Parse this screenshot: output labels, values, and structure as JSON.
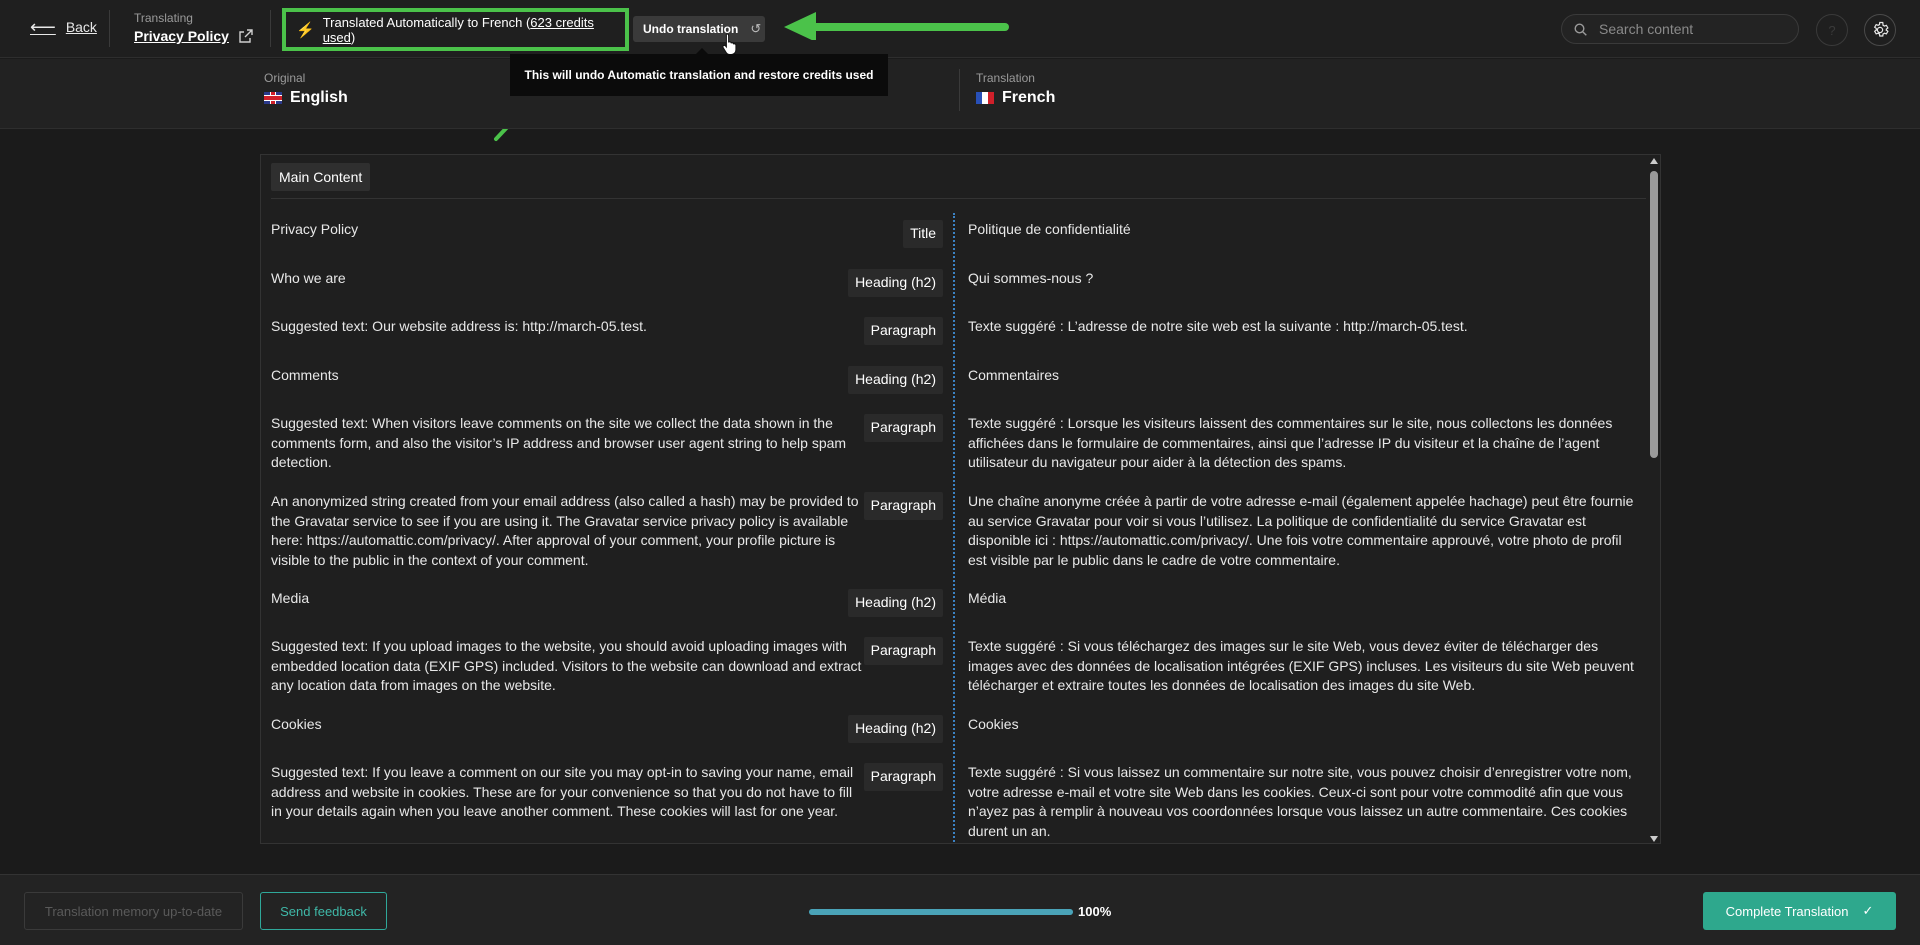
{
  "header": {
    "back_label": "Back",
    "translating_label": "Translating",
    "document_title": "Privacy Policy",
    "auto_status_prefix": "Translated Automatically to French (",
    "auto_status_credits": "623 credits used",
    "auto_status_suffix": ")",
    "undo_label": "Undo translation",
    "search_placeholder": "Search content",
    "help_icon": "help-icon",
    "settings_icon": "gear-icon"
  },
  "tooltip": {
    "text": "This will undo Automatic translation and restore credits used"
  },
  "languages": {
    "original_label": "Original",
    "original_name": "English",
    "translation_label": "Translation",
    "translation_name": "French"
  },
  "content": {
    "section": "Main Content",
    "rows": [
      {
        "original": "Privacy Policy",
        "type": "Title",
        "translation": "Politique de confidentialité"
      },
      {
        "original": "Who we are",
        "type": "Heading (h2)",
        "translation": "Qui sommes-nous ?"
      },
      {
        "original": "Suggested text: Our website address is: http://march-05.test.",
        "type": "Paragraph",
        "translation": "Texte suggéré : L’adresse de notre site web est la suivante : http://march-05.test."
      },
      {
        "original": "Comments",
        "type": "Heading (h2)",
        "translation": "Commentaires"
      },
      {
        "original": "Suggested text: When visitors leave comments on the site we collect the data shown in the comments form, and also the visitor’s IP address and browser user agent string to help spam detection.",
        "type": "Paragraph",
        "translation": "Texte suggéré : Lorsque les visiteurs laissent des commentaires sur le site, nous collectons les données affichées dans le formulaire de commentaires, ainsi que l’adresse IP du visiteur et la chaîne de l’agent utilisateur du navigateur pour aider à la détection des spams."
      },
      {
        "original": "An anonymized string created from your email address (also called a hash) may be provided to the Gravatar service to see if you are using it. The Gravatar service privacy policy is available here: https://automattic.com/privacy/. After approval of your comment, your profile picture is visible to the public in the context of your comment.",
        "type": "Paragraph",
        "translation": "Une chaîne anonyme créée à partir de votre adresse e-mail (également appelée hachage) peut être fournie au service Gravatar pour voir si vous l’utilisez. La politique de confidentialité du service Gravatar est disponible ici : https://automattic.com/privacy/. Une fois votre commentaire approuvé, votre photo de profil est visible par le public dans le cadre de votre commentaire."
      },
      {
        "original": "Media",
        "type": "Heading (h2)",
        "translation": "Média"
      },
      {
        "original": "Suggested text: If you upload images to the website, you should avoid uploading images with embedded location data (EXIF GPS) included. Visitors to the website can download and extract any location data from images on the website.",
        "type": "Paragraph",
        "translation": "Texte suggéré : Si vous téléchargez des images sur le site Web, vous devez éviter de télécharger des images avec des données de localisation intégrées (EXIF GPS) incluses. Les visiteurs du site Web peuvent télécharger et extraire toutes les données de localisation des images du site Web."
      },
      {
        "original": "Cookies",
        "type": "Heading (h2)",
        "translation": "Cookies"
      },
      {
        "original": "Suggested text: If you leave a comment on our site you may opt-in to saving your name, email address and website in cookies. These are for your convenience so that you do not have to fill in your details again when you leave another comment. These cookies will last for one year.",
        "type": "Paragraph",
        "translation": "Texte suggéré : Si vous laissez un commentaire sur notre site, vous pouvez choisir d’enregistrer votre nom, votre adresse e-mail et votre site Web dans les cookies. Ceux-ci sont pour votre commodité afin que vous n’ayez pas à remplir à nouveau vos coordonnées lorsque vous laissez un autre commentaire. Ces cookies durent un an."
      }
    ]
  },
  "footer": {
    "tm_label": "Translation memory up-to-date",
    "feedback_label": "Send feedback",
    "progress_fraction": 1.0,
    "progress_text": "100%",
    "complete_label": "Complete Translation"
  },
  "colors": {
    "highlight_green": "#4bc24a",
    "accent_teal": "#2ea88d",
    "bolt_blue": "#3a8de0"
  }
}
